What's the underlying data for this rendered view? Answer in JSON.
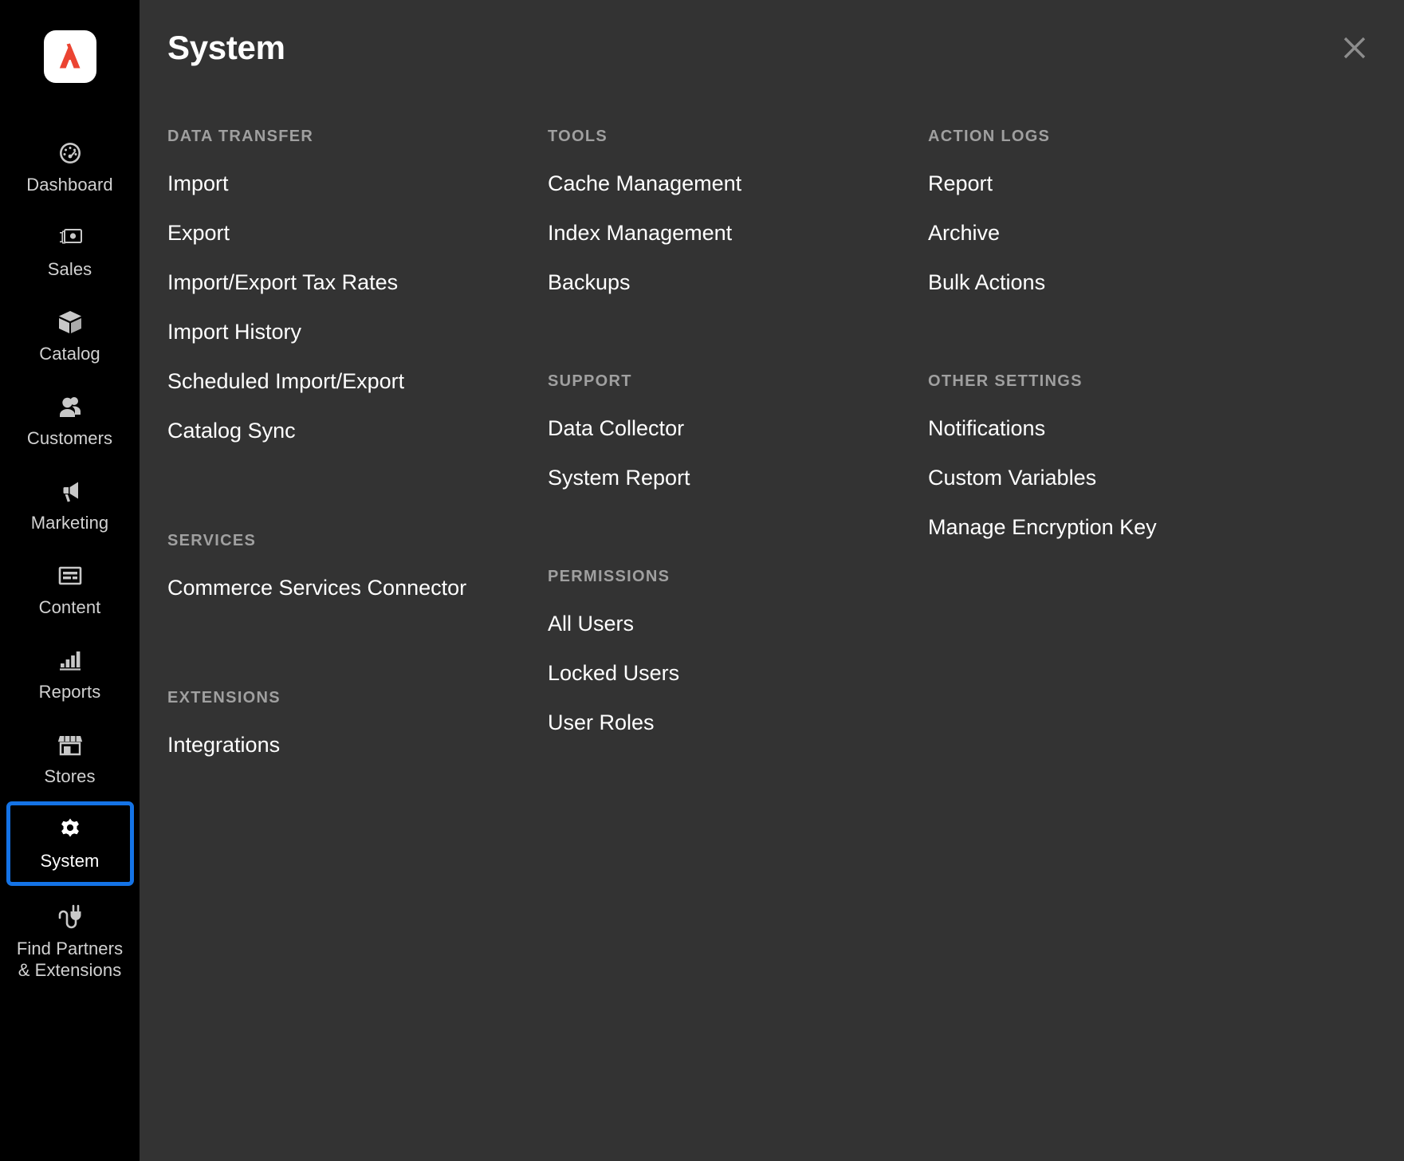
{
  "sidebar": {
    "logo": {
      "icon": "adobe-commerce-logo",
      "color": "#EB4432"
    },
    "items": [
      {
        "label": "Dashboard",
        "icon": "dashboard-gauge-icon",
        "focused": false
      },
      {
        "label": "Sales",
        "icon": "sales-money-icon",
        "focused": false
      },
      {
        "label": "Catalog",
        "icon": "catalog-box-icon",
        "focused": false
      },
      {
        "label": "Customers",
        "icon": "customers-people-icon",
        "focused": false
      },
      {
        "label": "Marketing",
        "icon": "marketing-megaphone-icon",
        "focused": false
      },
      {
        "label": "Content",
        "icon": "content-page-icon",
        "focused": false
      },
      {
        "label": "Reports",
        "icon": "reports-bar-chart-icon",
        "focused": false
      },
      {
        "label": "Stores",
        "icon": "stores-storefront-icon",
        "focused": false
      },
      {
        "label": "System",
        "icon": "system-gear-icon",
        "focused": true
      },
      {
        "label": "Find Partners\n& Extensions",
        "icon": "extensions-plug-icon",
        "focused": false
      }
    ],
    "focus_outline_color": "#1473E6"
  },
  "panel": {
    "title": "System",
    "close": {
      "label": "Close",
      "icon": "close-icon"
    },
    "columns": [
      {
        "groups": [
          {
            "title": "DATA TRANSFER",
            "links": [
              "Import",
              "Export",
              "Import/Export Tax Rates",
              "Import History",
              "Scheduled Import/Export",
              "Catalog Sync"
            ]
          },
          {
            "title": "SERVICES",
            "links": [
              "Commerce Services Connector"
            ]
          },
          {
            "title": "EXTENSIONS",
            "links": [
              "Integrations"
            ]
          }
        ]
      },
      {
        "groups": [
          {
            "title": "TOOLS",
            "links": [
              "Cache Management",
              "Index Management",
              "Backups"
            ]
          },
          {
            "title": "SUPPORT",
            "links": [
              "Data Collector",
              "System Report"
            ]
          },
          {
            "title": "PERMISSIONS",
            "links": [
              "All Users",
              "Locked Users",
              "User Roles"
            ]
          }
        ]
      },
      {
        "groups": [
          {
            "title": "ACTION LOGS",
            "links": [
              "Report",
              "Archive",
              "Bulk Actions"
            ]
          },
          {
            "title": "OTHER SETTINGS",
            "links": [
              "Notifications",
              "Custom Variables",
              "Manage Encryption Key"
            ]
          }
        ]
      }
    ]
  },
  "colors": {
    "sidebar_bg": "#000000",
    "panel_bg": "#333333",
    "group_title": "#A0A0A0",
    "link_text": "#FFFFFF",
    "nav_label": "#D2D2D2"
  }
}
